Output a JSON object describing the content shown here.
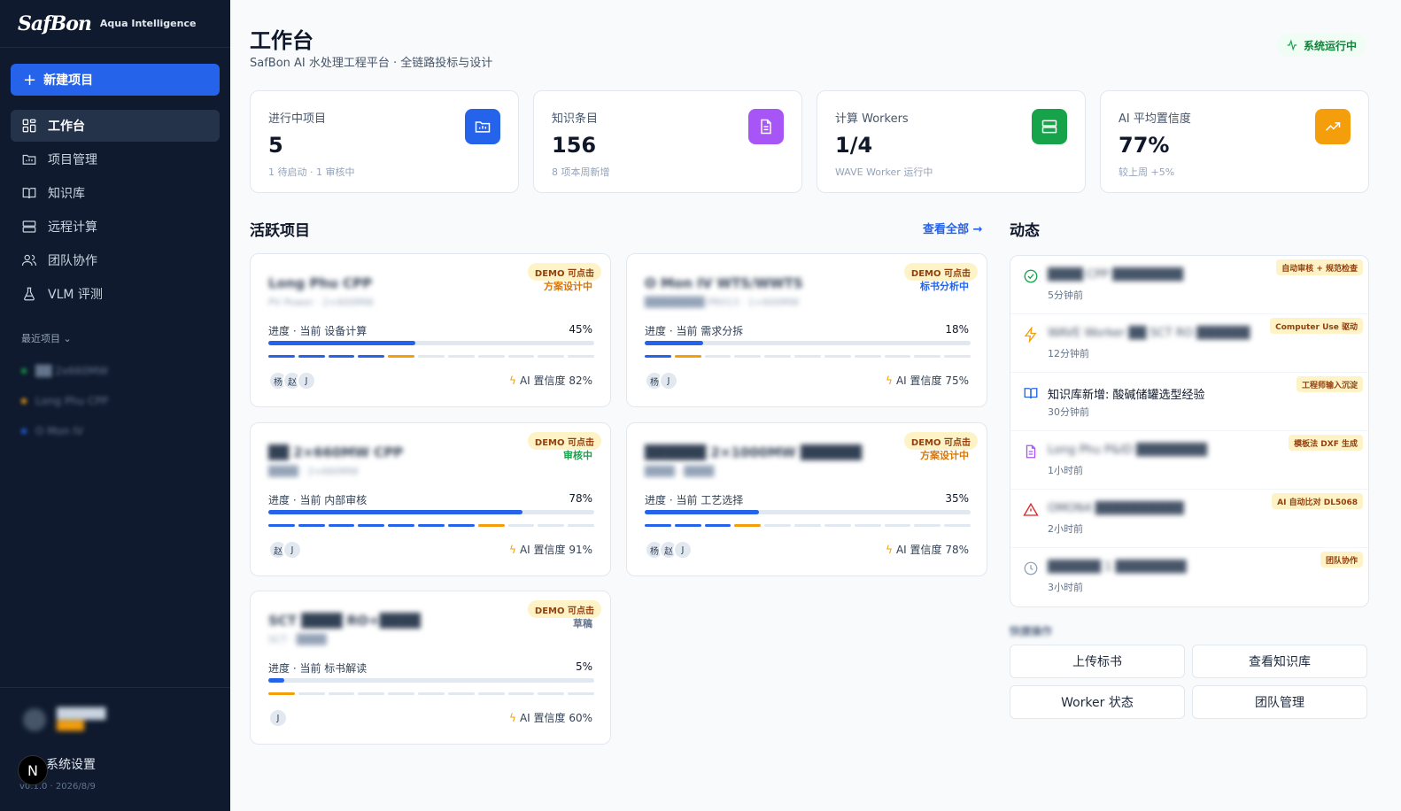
{
  "sidebar": {
    "brand_logo": "SafBon",
    "brand_sub": "Aqua Intelligence",
    "new_project": "新建项目",
    "nav": [
      {
        "label": "工作台",
        "icon": "grid-icon",
        "active": true
      },
      {
        "label": "项目管理",
        "icon": "folder-icon"
      },
      {
        "label": "知识库",
        "icon": "book-icon"
      },
      {
        "label": "远程计算",
        "icon": "server-icon"
      },
      {
        "label": "团队协作",
        "icon": "users-icon"
      },
      {
        "label": "VLM 评测",
        "icon": "flask-icon"
      }
    ],
    "recent_title": "最近项目",
    "recent_items": [
      {
        "label": "██ 2x660MW",
        "color": "#16a34a"
      },
      {
        "label": "Long Phu CPP",
        "color": "#f59e0b"
      },
      {
        "label": "O Mon IV",
        "color": "#2563eb"
      }
    ],
    "user_name": "██████",
    "user_role": "████",
    "settings": "系统设置",
    "version": "v0.1.0 · 2026/8/9",
    "n_badge": "N"
  },
  "header": {
    "title": "工作台",
    "subtitle": "SafBon AI 水处理工程平台 · 全链路投标与设计",
    "status": "系统运行中"
  },
  "stats": [
    {
      "label": "进行中项目",
      "value": "5",
      "note": "1 待启动 · 1 审核中",
      "icon": "folder-icon",
      "color": "#2563eb"
    },
    {
      "label": "知识条目",
      "value": "156",
      "note": "8 项本周新增",
      "icon": "document-icon",
      "color": "#a855f7"
    },
    {
      "label": "计算 Workers",
      "value": "1/4",
      "note": "WAVE Worker 运行中",
      "icon": "server-icon",
      "color": "#16a34a"
    },
    {
      "label": "AI 平均置信度",
      "value": "77%",
      "note": "较上周 +5%",
      "icon": "trend-up-icon",
      "color": "#f59e0b"
    }
  ],
  "active_title": "活跃项目",
  "view_all": "查看全部 →",
  "activity_title": "动态",
  "projects": [
    {
      "title": "Long Phu CPP",
      "sub": "PV Power · 2×600MW",
      "demo": "DEMO 可点击",
      "stage": "方案设计中",
      "stage_color": "#d97706",
      "progress_label": "进度 · 当前 设备计算",
      "progress": 45,
      "pct": "45%",
      "steps": [
        "done",
        "done",
        "done",
        "done",
        "cur",
        "todo",
        "todo",
        "todo",
        "todo",
        "todo",
        "todo"
      ],
      "avatars": [
        "杨",
        "赵",
        "J"
      ],
      "ai": "AI 置信度 82%"
    },
    {
      "title": "O Mon IV WTS/WWTS",
      "sub": "████████ PR013 · 1×600MW",
      "demo": "DEMO 可点击",
      "stage": "标书分析中",
      "stage_color": "#2563eb",
      "progress_label": "进度 · 当前 需求分拆",
      "progress": 18,
      "pct": "18%",
      "steps": [
        "done",
        "cur",
        "todo",
        "todo",
        "todo",
        "todo",
        "todo",
        "todo",
        "todo",
        "todo",
        "todo"
      ],
      "avatars": [
        "杨",
        "J"
      ],
      "ai": "AI 置信度 75%"
    },
    {
      "title": "██ 2×660MW CPP",
      "sub": "████ · 2×660MW",
      "demo": "DEMO 可点击",
      "stage": "审核中",
      "stage_color": "#16a34a",
      "progress_label": "进度 · 当前 内部审核",
      "progress": 78,
      "pct": "78%",
      "steps": [
        "done",
        "done",
        "done",
        "done",
        "done",
        "done",
        "done",
        "cur",
        "todo",
        "todo",
        "todo"
      ],
      "avatars": [
        "赵",
        "J"
      ],
      "ai": "AI 置信度 91%"
    },
    {
      "title": "██████ 2×1000MW ██████",
      "sub": "████ · ████",
      "demo": "DEMO 可点击",
      "stage": "方案设计中",
      "stage_color": "#d97706",
      "progress_label": "进度 · 当前 工艺选择",
      "progress": 35,
      "pct": "35%",
      "steps": [
        "done",
        "done",
        "done",
        "cur",
        "todo",
        "todo",
        "todo",
        "todo",
        "todo",
        "todo",
        "todo"
      ],
      "avatars": [
        "杨",
        "赵",
        "J"
      ],
      "ai": "AI 置信度 78%"
    },
    {
      "title": "SCT ████ RO+████",
      "sub": "SCT · ████",
      "demo": "DEMO 可点击",
      "stage": "草稿",
      "stage_color": "#64748b",
      "progress_label": "进度 · 当前 标书解读",
      "progress": 5,
      "pct": "5%",
      "steps": [
        "cur",
        "todo",
        "todo",
        "todo",
        "todo",
        "todo",
        "todo",
        "todo",
        "todo",
        "todo",
        "todo"
      ],
      "avatars": [
        "J"
      ],
      "ai": "AI 置信度 60%"
    }
  ],
  "activities": [
    {
      "text": "████ CPP ████████",
      "blur": true,
      "time": "5分钟前",
      "tag": "自动审核 + 规范检查",
      "icon": "check-circle-icon",
      "color": "#16a34a"
    },
    {
      "text": "WAVE Worker ██ SCT RO ██████",
      "blur": true,
      "time": "12分钟前",
      "tag": "Computer Use 驱动",
      "icon": "bolt-icon",
      "color": "#f59e0b"
    },
    {
      "text": "知识库新增: 酸碱储罐选型经验",
      "blur": false,
      "time": "30分钟前",
      "tag": "工程师输入沉淀",
      "icon": "book-icon",
      "color": "#2563eb"
    },
    {
      "text": "Long Phu P&ID ████████",
      "blur": true,
      "time": "1小时前",
      "tag": "模板法 DXF 生成",
      "icon": "document-icon",
      "color": "#a855f7"
    },
    {
      "text": "OMON4 ██████████",
      "blur": true,
      "time": "2小时前",
      "tag": "AI 自动比对 DL5068",
      "icon": "alert-icon",
      "color": "#dc2626"
    },
    {
      "text": "██████ 1 ████████",
      "blur": true,
      "time": "3小时前",
      "tag": "团队协作",
      "icon": "clock-icon",
      "color": "#94a3b8"
    }
  ],
  "quick_title": "快捷操作",
  "quick_actions": [
    "上传标书",
    "查看知识库",
    "Worker 状态",
    "团队管理"
  ]
}
